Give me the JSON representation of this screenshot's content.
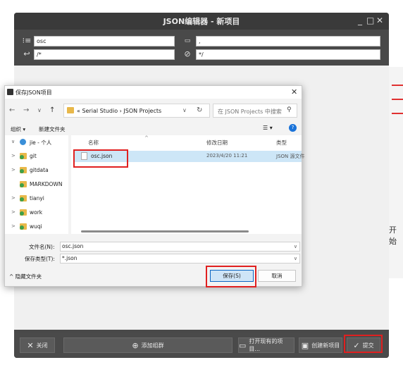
{
  "editor": {
    "title": "JSON编辑器 - 新项目",
    "window_controls": [
      "_",
      "□",
      "✕"
    ],
    "fields": {
      "project_title": "osc",
      "separator": ",",
      "frame_start": "/*",
      "frame_end": "*/"
    },
    "bottom_buttons": {
      "close": "关闭",
      "add_group": "添加组群",
      "open_existing": "打开现有的项目...",
      "create_new": "创建新项目",
      "apply": "提交"
    }
  },
  "dialog": {
    "title": "保存JSON项目",
    "close": "✕",
    "nav": {
      "back": "←",
      "forward": "→",
      "recent": "∨",
      "up": "↑"
    },
    "address": {
      "path": "« Serial Studio › JSON Projects",
      "dropdown": "∨",
      "refresh": "↻"
    },
    "search": {
      "placeholder": "在 JSON Projects 中搜索"
    },
    "toolbar": {
      "organize": "组织 ▾",
      "new_folder": "新建文件夹",
      "view": "☰ ▾",
      "help": "?"
    },
    "sidebar": [
      {
        "chevron": "∨",
        "label": "jie - 个人"
      },
      {
        "chevron": ">",
        "label": "git"
      },
      {
        "chevron": ">",
        "label": "gitdata"
      },
      {
        "chevron": "",
        "label": "MARKDOWN"
      },
      {
        "chevron": ">",
        "label": "tianyi"
      },
      {
        "chevron": ">",
        "label": "work"
      },
      {
        "chevron": ">",
        "label": "wuqi"
      }
    ],
    "columns": {
      "name": "名称",
      "date": "修改日期",
      "type": "类型"
    },
    "files": [
      {
        "name": "osc.json",
        "date": "2023/4/20 11:21",
        "type": "JSON 源文件"
      }
    ],
    "filename_label": "文件名(N):",
    "filename_value": "osc.json",
    "filetype_label": "保存类型(T):",
    "filetype_value": "*.json",
    "hide_folders": "^ 隐藏文件夹",
    "save_label": "保存(S)",
    "cancel_label": "取消"
  },
  "background": {
    "partial_text": "开始"
  },
  "colors": {
    "editor_bg": "#494949",
    "selection": "#cde6f7",
    "annotation_red": "#e02020",
    "primary_border": "#0b66c3"
  }
}
